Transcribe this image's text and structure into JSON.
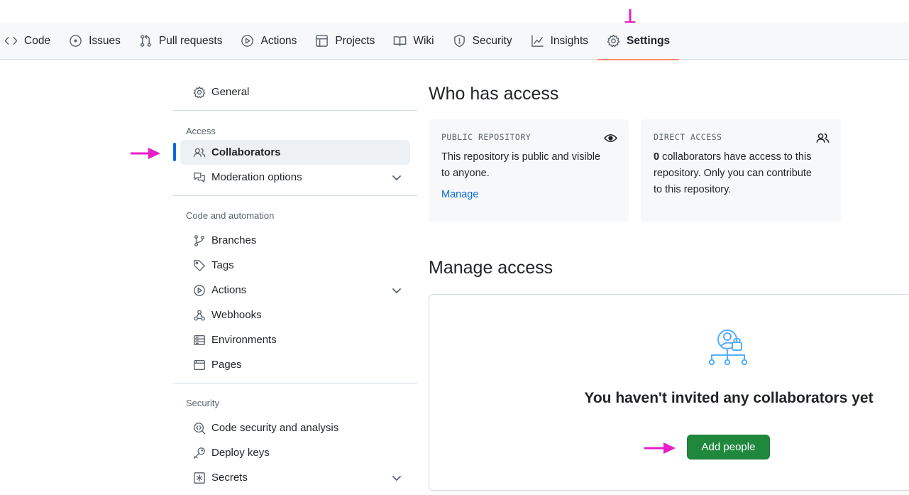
{
  "repo_nav": {
    "items": [
      {
        "label": "Code",
        "icon": "code-icon"
      },
      {
        "label": "Issues",
        "icon": "issue-opened-icon"
      },
      {
        "label": "Pull requests",
        "icon": "git-pull-request-icon"
      },
      {
        "label": "Actions",
        "icon": "play-icon"
      },
      {
        "label": "Projects",
        "icon": "table-icon"
      },
      {
        "label": "Wiki",
        "icon": "book-icon"
      },
      {
        "label": "Security",
        "icon": "shield-icon"
      },
      {
        "label": "Insights",
        "icon": "graph-icon"
      },
      {
        "label": "Settings",
        "icon": "gear-icon",
        "active": true
      }
    ]
  },
  "sidebar": {
    "general": "General",
    "access_heading": "Access",
    "collaborators": "Collaborators",
    "moderation": "Moderation options",
    "code_heading": "Code and automation",
    "branches": "Branches",
    "tags": "Tags",
    "actions": "Actions",
    "webhooks": "Webhooks",
    "environments": "Environments",
    "pages": "Pages",
    "security_heading": "Security",
    "code_security": "Code security and analysis",
    "deploy_keys": "Deploy keys",
    "secrets": "Secrets"
  },
  "main": {
    "who_has_access": "Who has access",
    "public_card": {
      "title": "PUBLIC REPOSITORY",
      "line1": "This repository is public and visible",
      "line2": "to anyone.",
      "link": "Manage"
    },
    "direct_card": {
      "title": "DIRECT ACCESS",
      "count": "0",
      "line1": " collaborators have access to this",
      "line2": "repository. Only you can contribute",
      "line3": "to this repository."
    },
    "manage_access": "Manage access",
    "empty_title": "You haven't invited any collaborators yet",
    "add_people": "Add people"
  },
  "colors": {
    "accent": "#0969da",
    "button": "#1f883d",
    "annotation_arrow": "#e81cc9",
    "active_tab": "#fd8c73"
  }
}
